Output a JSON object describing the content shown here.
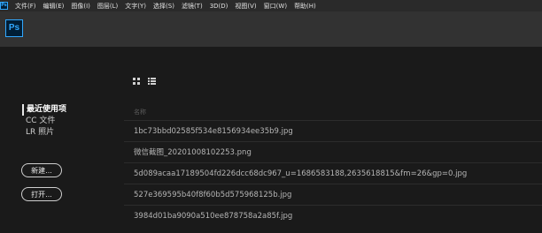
{
  "menubar": {
    "app_icon": "Ps",
    "items": [
      {
        "label": "文件(F)"
      },
      {
        "label": "编辑(E)"
      },
      {
        "label": "图像(I)"
      },
      {
        "label": "图层(L)"
      },
      {
        "label": "文字(Y)"
      },
      {
        "label": "选择(S)"
      },
      {
        "label": "滤镜(T)"
      },
      {
        "label": "3D(D)"
      },
      {
        "label": "视图(V)"
      },
      {
        "label": "窗口(W)"
      },
      {
        "label": "帮助(H)"
      }
    ]
  },
  "topbar": {
    "logo_text": "Ps"
  },
  "sidebar": {
    "items": [
      {
        "label": "最近使用项",
        "active": true
      },
      {
        "label": "CC 文件",
        "active": false
      },
      {
        "label": "LR 照片",
        "active": false
      }
    ],
    "new_button": "新建...",
    "open_button": "打开..."
  },
  "view_toggles": {
    "grid": "grid-view-icon",
    "list": "list-view-icon"
  },
  "files": {
    "column_header": "名称",
    "rows": [
      {
        "name": "1bc73bbd02585f534e8156934ee35b9.jpg"
      },
      {
        "name": "微信截图_20201008102253.png"
      },
      {
        "name": "5d089acaa17189504fd226dcc68dc967_u=1686583188,2635618815&fm=26&gp=0.jpg"
      },
      {
        "name": "527e369595b40f8f60b5d575968125b.jpg"
      },
      {
        "name": "3984d01ba9090a510ee878758a2a85f.jpg"
      }
    ]
  },
  "colors": {
    "background": "#1a1a1a",
    "menubar": "#2a2a2a",
    "topbar": "#323232",
    "ps_blue": "#31a8ff",
    "ps_dark": "#001e36"
  }
}
